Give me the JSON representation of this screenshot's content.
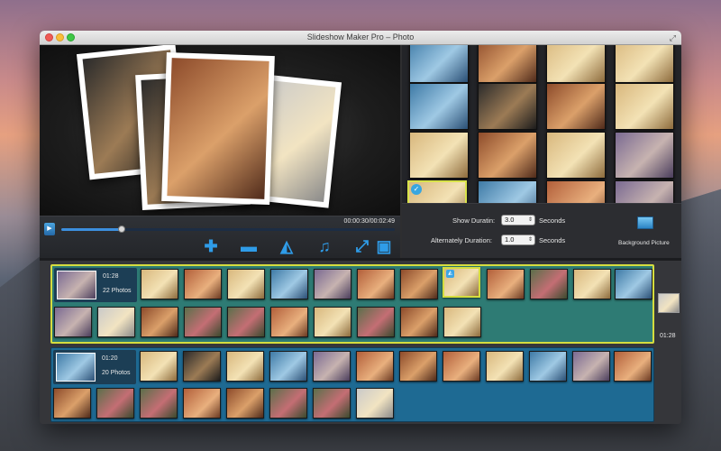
{
  "window": {
    "title": "Slideshow Maker Pro – Photo"
  },
  "player": {
    "time": "00:00:30/00:02:49",
    "progress_fraction": 0.18,
    "play_icon": "play-icon",
    "tools": [
      {
        "name": "add-photo-icon",
        "glyph": "✚"
      },
      {
        "name": "remove-photo-icon",
        "glyph": "▬"
      },
      {
        "name": "transition-icon",
        "glyph": "◭"
      },
      {
        "name": "music-icon",
        "glyph": "♫"
      },
      {
        "name": "fullscreen-icon",
        "glyph": "⤢"
      },
      {
        "name": "save-icon",
        "glyph": "▣"
      }
    ]
  },
  "settings": {
    "show_duration_label": "Show Duratin:",
    "show_duration_value": "3.0",
    "show_duration_unit": "Seconds",
    "alt_duration_label": "Alternately Duration:",
    "alt_duration_value": "1.0",
    "alt_duration_unit": "Seconds",
    "background_picture_label": "Background Picture"
  },
  "timeline": {
    "groups": [
      {
        "duration": "01:28",
        "count": "22 Photos"
      },
      {
        "duration": "01:20",
        "count": "20 Photos"
      }
    ],
    "side_time": "01:28"
  },
  "colors": {
    "accent": "#2f9ce8",
    "group1_bg": "#2e7b74",
    "group1_border": "#d4dd3f",
    "group2_bg": "#1e6a93"
  }
}
